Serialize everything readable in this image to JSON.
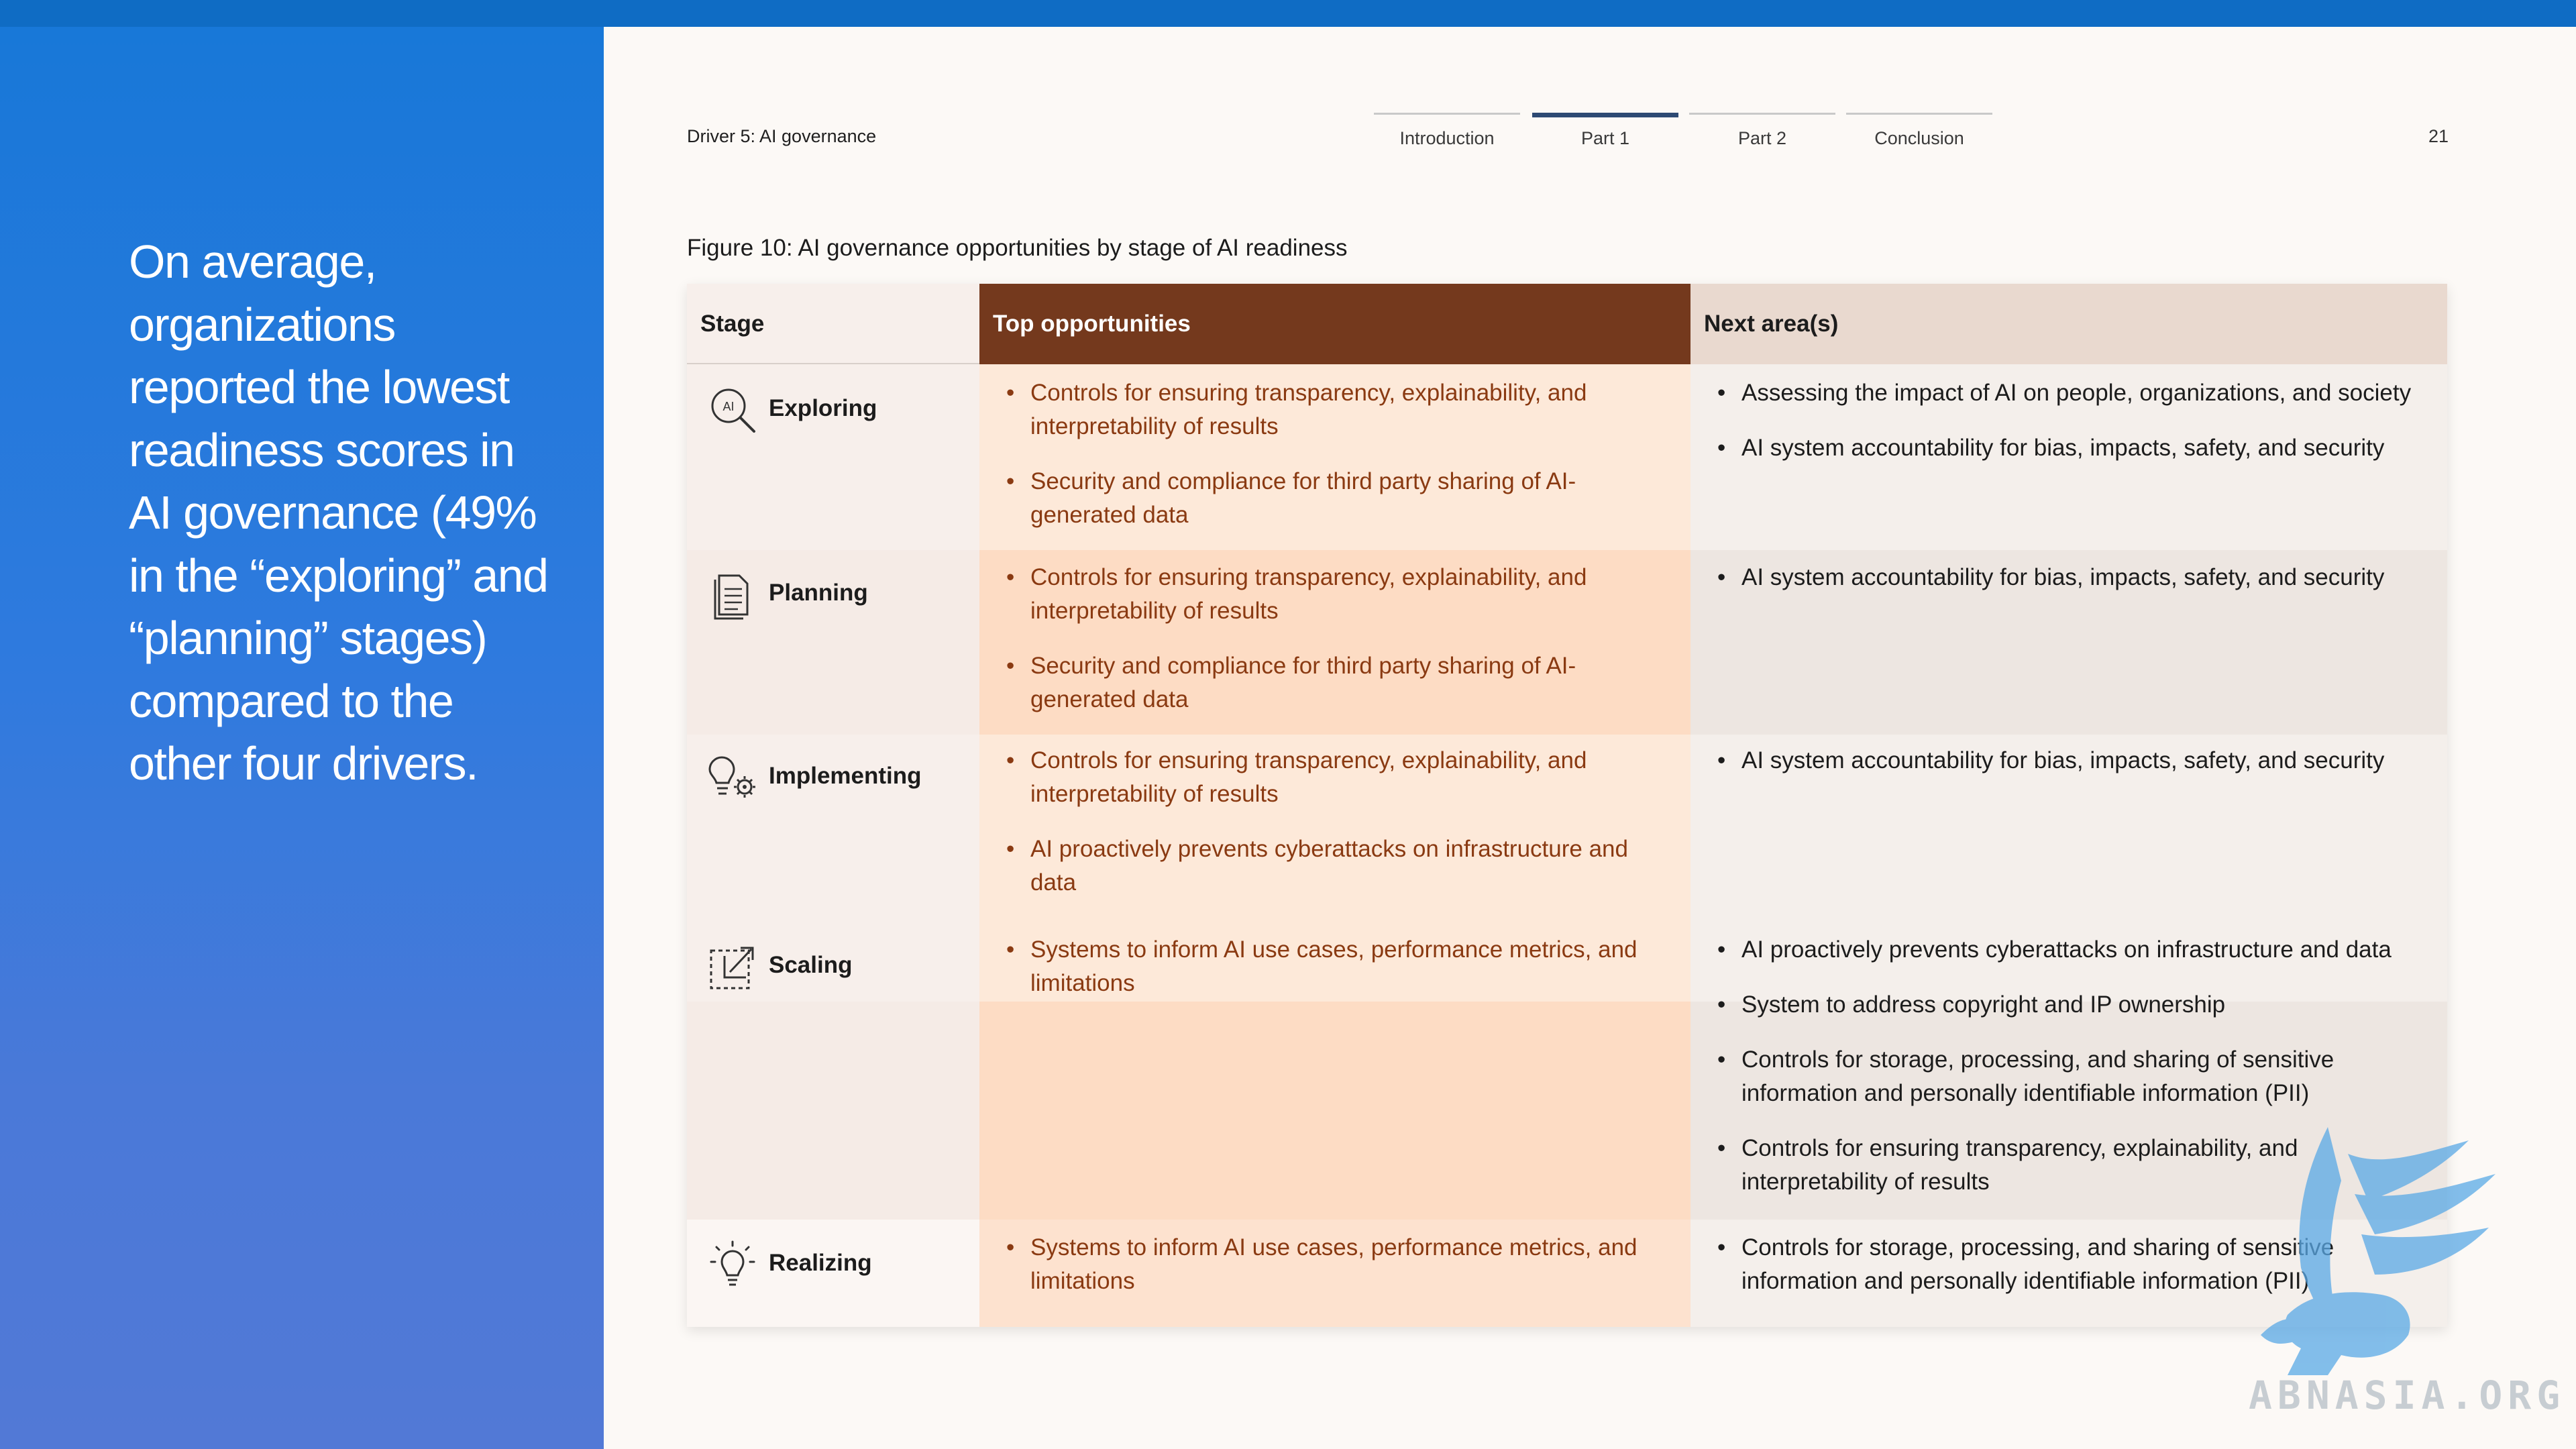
{
  "header": {
    "section": "Driver 5: AI governance",
    "page_number": "21",
    "nav": [
      {
        "label": "Introduction",
        "active": false
      },
      {
        "label": "Part 1",
        "active": true
      },
      {
        "label": "Part 2",
        "active": false
      },
      {
        "label": "Conclusion",
        "active": false
      }
    ]
  },
  "side_panel": {
    "quote": "On average, organizations reported the lowest readiness scores in AI governance (49% in the “exploring” and “planning” stages) compared to the other four drivers."
  },
  "figure": {
    "title": "Figure 10: AI governance opportunities by stage of AI readiness",
    "columns": [
      "Stage",
      "Top opportunities",
      "Next area(s)"
    ],
    "rows": [
      {
        "stage": "Exploring",
        "icon": "ai-magnifier-icon",
        "icon_text": "AI",
        "opportunities": [
          "Controls for ensuring transparency, explainability, and interpretability of results",
          "Security and compliance for third party sharing of AI-generated data"
        ],
        "next": [
          "Assessing the impact of AI on people, organizations, and society",
          "AI system accountability for bias, impacts, safety, and security"
        ]
      },
      {
        "stage": "Planning",
        "icon": "document-icon",
        "opportunities": [
          "Controls for ensuring transparency, explainability, and interpretability of results",
          "Security and compliance for third party sharing of AI-generated data"
        ],
        "next": [
          "AI system accountability for bias, impacts, safety, and security"
        ]
      },
      {
        "stage": "Implementing",
        "icon": "lightbulb-gear-icon",
        "opportunities": [
          "Controls for ensuring transparency, explainability, and interpretability of results",
          "AI proactively prevents cyberattacks on infrastructure and data"
        ],
        "next": [
          "AI system accountability for bias, impacts, safety, and security"
        ]
      },
      {
        "stage": "Scaling",
        "icon": "expand-box-icon",
        "opportunities": [
          "Systems to inform AI use cases, performance metrics, and limitations"
        ],
        "next": [
          "AI proactively prevents cyberattacks on infrastructure and data",
          "System to address copyright and IP ownership",
          "Controls for storage, processing, and sharing of sensitive information and personally identifiable information (PII)",
          "Controls for ensuring transparency, explainability, and interpretability of results"
        ]
      },
      {
        "stage": "Realizing",
        "icon": "lightbulb-shine-icon",
        "opportunities": [
          "Systems to inform AI use cases, performance metrics, and limitations"
        ],
        "next": [
          "Controls for storage, processing, and sharing of sensitive information and personally identifiable information (PII)"
        ]
      }
    ]
  },
  "watermark": {
    "text": "ABNASIA.ORG"
  },
  "colors": {
    "top_bar": "#0f6cc4",
    "side_panel": "#2f7ade",
    "opportunity_header": "#74391d",
    "opportunity_text": "#8a3a12",
    "next_header": "#e9d9cf"
  }
}
